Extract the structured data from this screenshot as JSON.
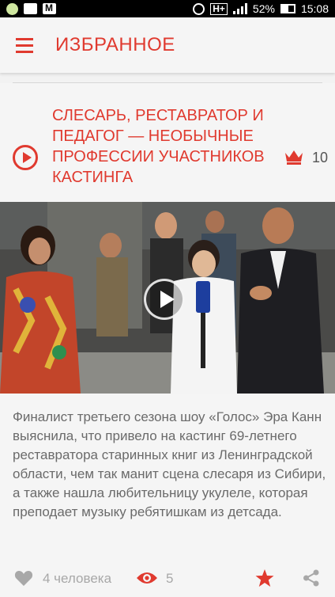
{
  "status_bar": {
    "battery": "52%",
    "time": "15:08",
    "network": "H+",
    "icons": [
      "notification-icon",
      "image-icon",
      "mail-icon",
      "alarm-icon",
      "signal-icon",
      "battery-icon"
    ]
  },
  "app_bar": {
    "title": "ИЗБРАННОЕ",
    "menu_icon": "hamburger-menu-icon"
  },
  "article": {
    "title": "СЛЕСАРЬ, РЕСТАВРАТОР И ПЕДАГОГ — НЕОБЫЧНЫЕ ПРОФЕССИИ УЧАСТНИКОВ КАСТИНГА",
    "crown_count": "10",
    "description": "Финалист третьего сезона шоу «Голос» Эра Канн выяснила, что привело на кастинг 69-летнего реставратора старинных книг из Ленинградской области, чем так манит сцена слесаря из Сибири, а также нашла любительницу укулеле, которая преподает музыку ребятишкам из детсада.",
    "likes": "4 человека",
    "views": "5"
  },
  "colors": {
    "accent": "#e03a2f",
    "text_muted": "#6a6a6a",
    "icon_gray": "#a8a8a8"
  }
}
